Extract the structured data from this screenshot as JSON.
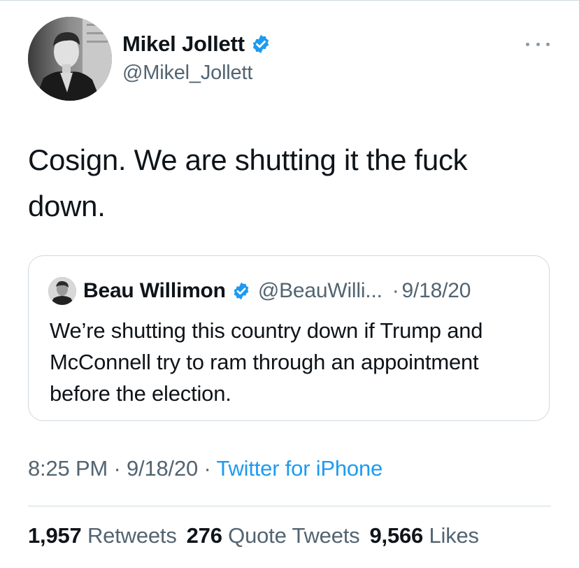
{
  "author": {
    "name": "Mikel Jollett",
    "handle": "@Mikel_Jollett"
  },
  "tweet": {
    "text": "Cosign. We are shutting it the fuck down."
  },
  "quoted_tweet": {
    "name": "Beau Willimon",
    "handle": "@BeauWilli...",
    "separator": "·",
    "date": "9/18/20",
    "text": "We’re shutting this country down if Trump and McConnell try to ram through an appointment before the election."
  },
  "meta": {
    "time": "8:25 PM",
    "sep1": " · ",
    "date": "9/18/20",
    "sep2": " · ",
    "source": "Twitter for iPhone"
  },
  "stats": {
    "retweets_count": "1,957",
    "retweets_label": "Retweets",
    "quotes_count": "276",
    "quotes_label": "Quote Tweets",
    "likes_count": "9,566",
    "likes_label": "Likes"
  },
  "colors": {
    "verified": "#1d9bf0",
    "link": "#1d9bf0",
    "secondary_text": "#536471"
  },
  "icons": {
    "verified": "verified-badge-icon",
    "more": "more-horizontal-icon"
  }
}
